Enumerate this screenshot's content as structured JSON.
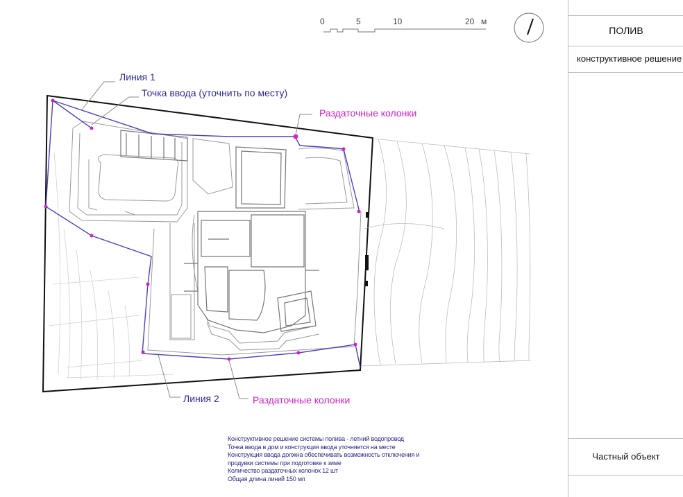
{
  "scale_bar": {
    "labels": [
      "0",
      "5",
      "10",
      "20"
    ],
    "unit": "м"
  },
  "callouts": {
    "line1": "Линия 1",
    "entry_point": "Точка ввода (уточнить по месту)",
    "columns_top": "Раздаточные колонки",
    "line2": "Линия 2",
    "columns_bottom": "Раздаточные колонки"
  },
  "notes": [
    "Конструктивное решение системы полива  - летний водопровод",
    "Точка ввода в дом и конструкция ввода уточняется на месте",
    "Конструкция ввода должна обеспечивать возможность отключения и",
    "продувки системы при подготовке к зиме",
    "Количество раздаточных колонок 12 шт",
    "Общая длина линий 150 мп"
  ],
  "stamp": {
    "title": "ПОЛИВ",
    "subtitle": "конструктивное решение",
    "object": "Частный объект"
  },
  "colors": {
    "line": "#4b40c8",
    "column": "#d020c8",
    "label_blue": "#2a2a9a",
    "label_magenta": "#d020c8"
  }
}
